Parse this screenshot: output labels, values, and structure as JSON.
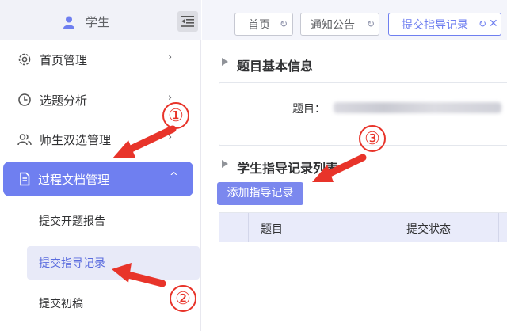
{
  "sidebar": {
    "user": {
      "name": "学生"
    },
    "menu": [
      {
        "label": "首页管理",
        "arrow": "›"
      },
      {
        "label": "选题分析",
        "arrow": "›"
      },
      {
        "label": "师生双选管理",
        "arrow": "›"
      },
      {
        "label": "过程文档管理",
        "arrow": "^"
      }
    ],
    "submenu": [
      {
        "label": "提交开题报告"
      },
      {
        "label": "提交指导记录"
      },
      {
        "label": "提交初稿"
      }
    ]
  },
  "tabs": [
    {
      "label": "首页"
    },
    {
      "label": "通知公告"
    },
    {
      "label": "提交指导记录",
      "active": true
    }
  ],
  "main": {
    "basic_info": {
      "title": "题目基本信息",
      "topic_label": "题目："
    },
    "record_list": {
      "title": "学生指导记录列表"
    },
    "add_button": "添加指导记录",
    "table": {
      "columns": [
        "题目",
        "提交状态"
      ]
    }
  },
  "annotations": [
    "①",
    "②",
    "③"
  ],
  "colors": {
    "accent": "#6f7ff0",
    "annotation_red": "#e8342a"
  }
}
